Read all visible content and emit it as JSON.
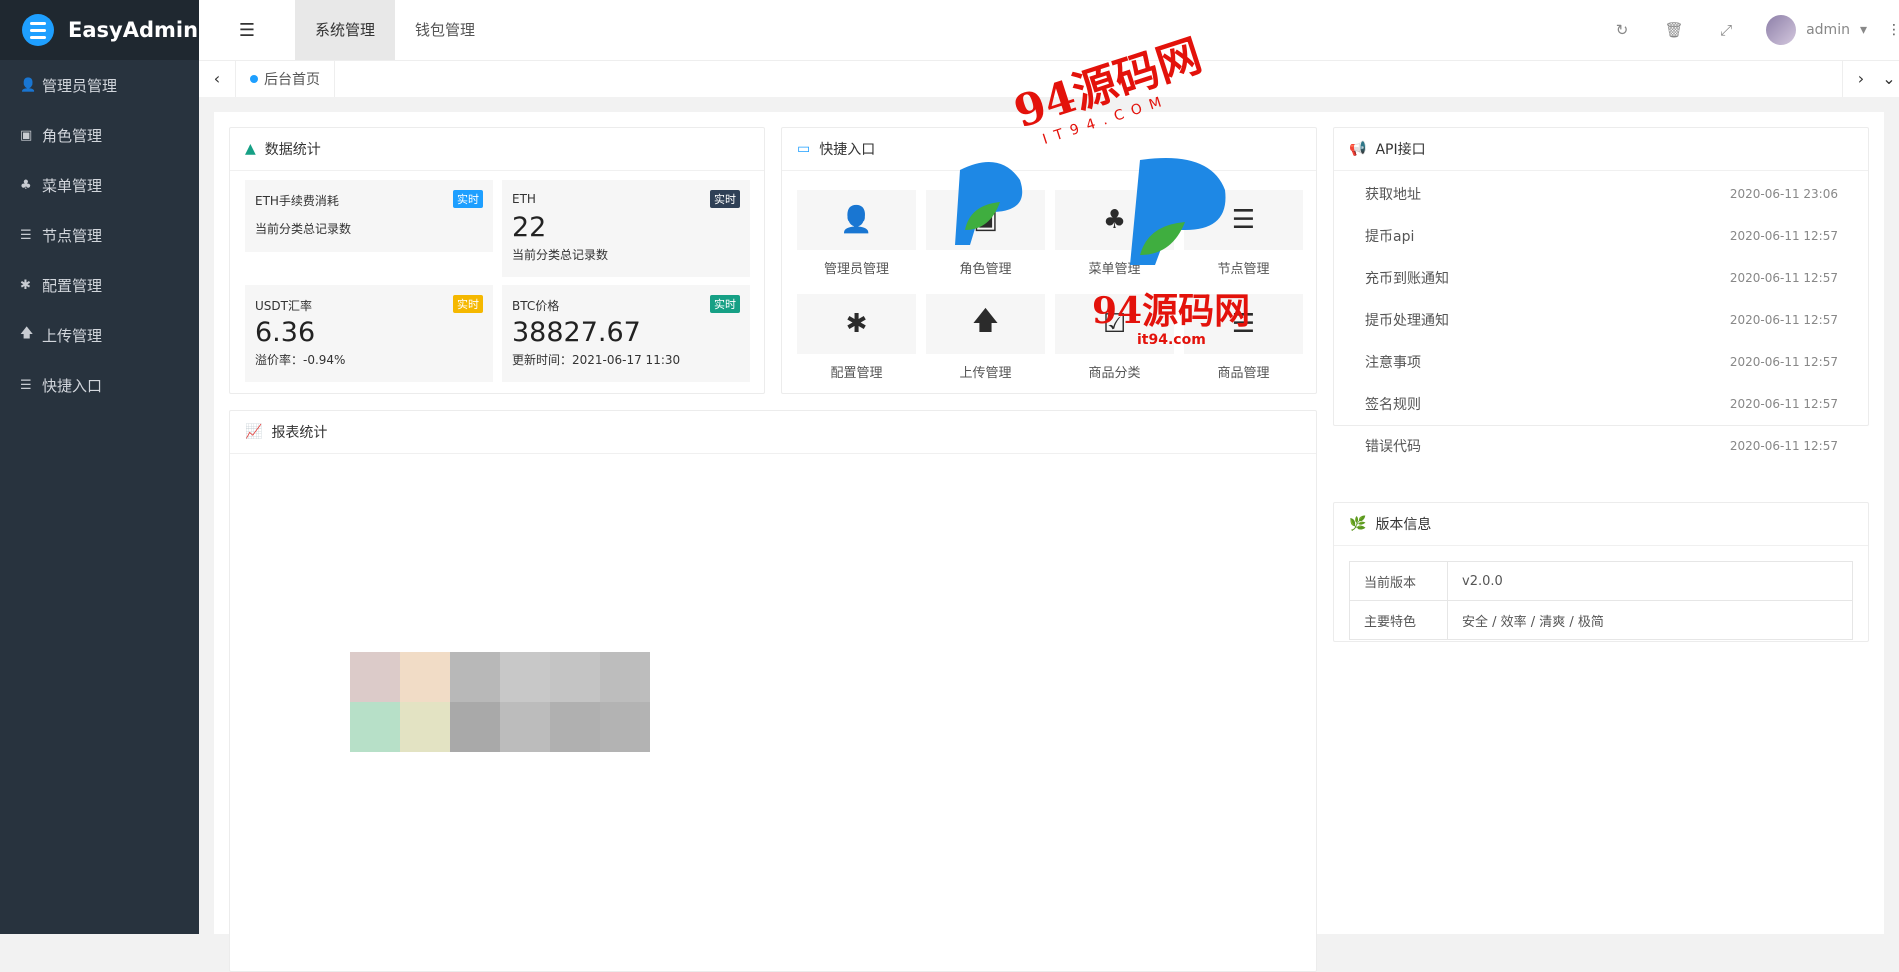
{
  "app": {
    "name": "EasyAdmin"
  },
  "sidebar": {
    "items": [
      {
        "label": "管理员管理",
        "icon": "user-icon",
        "glyph": "👤"
      },
      {
        "label": "角色管理",
        "icon": "id-card-icon",
        "glyph": "▣"
      },
      {
        "label": "菜单管理",
        "icon": "tree-icon",
        "glyph": "♣"
      },
      {
        "label": "节点管理",
        "icon": "list-icon",
        "glyph": "☰"
      },
      {
        "label": "配置管理",
        "icon": "asterisk-icon",
        "glyph": "✱"
      },
      {
        "label": "上传管理",
        "icon": "arrow-up-icon",
        "glyph": "🡅"
      },
      {
        "label": "快捷入口",
        "icon": "list-icon",
        "glyph": "☰"
      }
    ]
  },
  "topbar": {
    "tabs": [
      {
        "label": "系统管理",
        "active": true
      },
      {
        "label": "钱包管理",
        "active": false
      }
    ],
    "user": {
      "name": "admin"
    }
  },
  "pagetabs": {
    "current": "后台首页"
  },
  "stats": {
    "title": "数据统计",
    "items": [
      {
        "label": "ETH手续费消耗",
        "badge": "实时",
        "badge_color": "#1e9fff",
        "value": "",
        "sub": "当前分类总记录数"
      },
      {
        "label": "ETH",
        "badge": "实时",
        "badge_color": "#2f4056",
        "value": "22",
        "sub": "当前分类总记录数"
      },
      {
        "label": "USDT汇率",
        "badge": "实时",
        "badge_color": "#f5b800",
        "value": "6.36",
        "sub": "溢价率：-0.94%"
      },
      {
        "label": "BTC价格",
        "badge": "实时",
        "badge_color": "#16a085",
        "value": "38827.67",
        "sub": "更新时间：2021-06-17 11:30"
      }
    ]
  },
  "quick": {
    "title": "快捷入口",
    "items": [
      {
        "label": "管理员管理",
        "icon": "user-icon"
      },
      {
        "label": "角色管理",
        "icon": "id-card-icon"
      },
      {
        "label": "菜单管理",
        "icon": "tree-icon"
      },
      {
        "label": "节点管理",
        "icon": "list-icon"
      },
      {
        "label": "配置管理",
        "icon": "asterisk-icon"
      },
      {
        "label": "上传管理",
        "icon": "arrow-up-icon"
      },
      {
        "label": "商品分类",
        "icon": "calendar-check-icon"
      },
      {
        "label": "商品管理",
        "icon": "list-icon"
      }
    ]
  },
  "report": {
    "title": "报表统计"
  },
  "api": {
    "title": "API接口",
    "items": [
      {
        "label": "获取地址",
        "date": "2020-06-11 23:06"
      },
      {
        "label": "提币api",
        "date": "2020-06-11 12:57"
      },
      {
        "label": "充币到账通知",
        "date": "2020-06-11 12:57"
      },
      {
        "label": "提币处理通知",
        "date": "2020-06-11 12:57"
      },
      {
        "label": "注意事项",
        "date": "2020-06-11 12:57"
      },
      {
        "label": "签名规则",
        "date": "2020-06-11 12:57"
      },
      {
        "label": "错误代码",
        "date": "2020-06-11 12:57"
      }
    ]
  },
  "version": {
    "title": "版本信息",
    "rows": [
      {
        "key": "当前版本",
        "value": "v2.0.0"
      },
      {
        "key": "主要特色",
        "value": "安全 / 效率 / 清爽 / 极简"
      }
    ]
  },
  "watermark": {
    "line1": "94源码网",
    "line2": "IT94.COM",
    "line3": "94源码网",
    "line4": "it94.com"
  }
}
